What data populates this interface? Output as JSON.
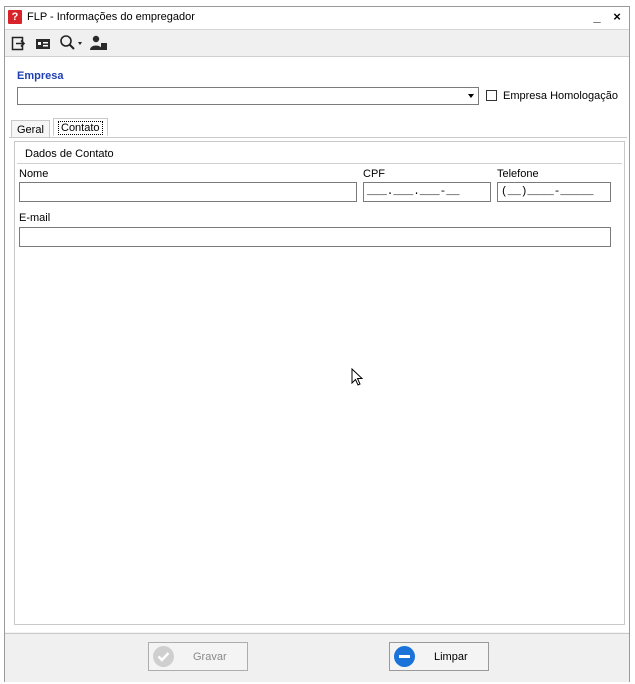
{
  "window": {
    "title": "FLP - Informações do empregador",
    "app_icon_glyph": "?",
    "minimize_glyph": "_",
    "close_glyph": "×"
  },
  "toolbar": {
    "items": [
      {
        "name": "exit-icon"
      },
      {
        "name": "id-card-icon"
      },
      {
        "name": "search-dropdown-icon"
      },
      {
        "name": "user-icon"
      }
    ]
  },
  "empresa": {
    "label": "Empresa",
    "value": "",
    "homologacao_label": "Empresa Homologação",
    "homologacao_checked": false
  },
  "tabs": [
    {
      "label": "Geral",
      "active": false
    },
    {
      "label": "Contato",
      "active": true
    }
  ],
  "contato": {
    "section_title": "Dados de Contato",
    "nome_label": "Nome",
    "nome_value": "",
    "cpf_label": "CPF",
    "cpf_mask": "___.___.___-__",
    "telefone_label": "Telefone",
    "telefone_mask": "(__)____-_____",
    "email_label": "E-mail",
    "email_value": ""
  },
  "footer": {
    "gravar_label": "Gravar",
    "limpar_label": "Limpar"
  },
  "colors": {
    "accent_label": "#1f3fb4",
    "app_icon": "#d8232a",
    "limpar_icon": "#1a73d9"
  }
}
